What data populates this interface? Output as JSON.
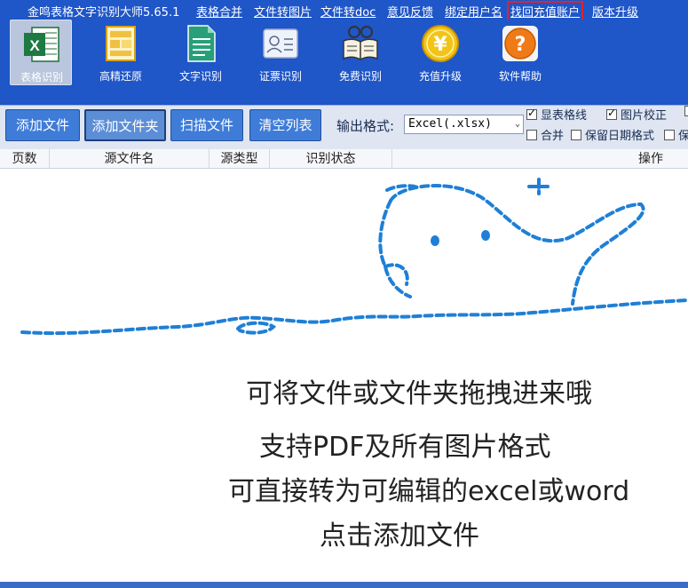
{
  "titlebar": {
    "app_title": "金鸣表格文字识别大师5.65.1",
    "menu": [
      "表格合并",
      "文件转图片",
      "文件转doc",
      "意见反馈",
      "绑定用户名",
      "找回充值账户",
      "版本升级"
    ]
  },
  "ribbon": {
    "tools": [
      {
        "label": "表格识别",
        "icon": "excel-icon",
        "active": true
      },
      {
        "label": "高精还原",
        "icon": "layout-icon"
      },
      {
        "label": "文字识别",
        "icon": "document-icon"
      },
      {
        "label": "证票识别",
        "icon": "id-card-icon"
      },
      {
        "label": "免费识别",
        "icon": "book-icon"
      },
      {
        "label": "充值升级",
        "icon": "yen-coin-icon"
      },
      {
        "label": "软件帮助",
        "icon": "help-icon"
      }
    ]
  },
  "actions": {
    "add_file": "添加文件",
    "add_folder": "添加文件夹",
    "scan_file": "扫描文件",
    "clear_list": "清空列表",
    "format_label": "输出格式:",
    "format_value": "Excel(.xlsx)"
  },
  "options": {
    "show_grid": "显表格线",
    "image_correct": "图片校正",
    "merge": "合并",
    "keep_date": "保留日期格式",
    "keep_cut": "保"
  },
  "table": {
    "columns": [
      "页数",
      "源文件名",
      "源类型",
      "识别状态",
      "操作"
    ]
  },
  "hints": {
    "line1": "可将文件或文件夹拖拽进来哦",
    "line2": "支持PDF及所有图片格式",
    "line3": "可直接转为可编辑的excel或word",
    "line4": "点击添加文件"
  },
  "colors": {
    "toolbar_blue": "#1f56c8",
    "button_blue": "#3f7cd8",
    "highlight_red": "#e0242b"
  }
}
